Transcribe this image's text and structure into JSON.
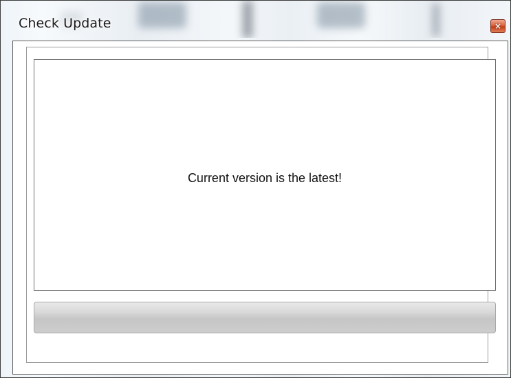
{
  "window": {
    "title": "Check Update",
    "close_icon": "close-icon",
    "close_glyph": "×"
  },
  "main": {
    "message": "Current version is the latest!",
    "progress_fraction": 0
  },
  "colors": {
    "close_button": "#c33c15",
    "progress_track": "#cdcdcd"
  }
}
